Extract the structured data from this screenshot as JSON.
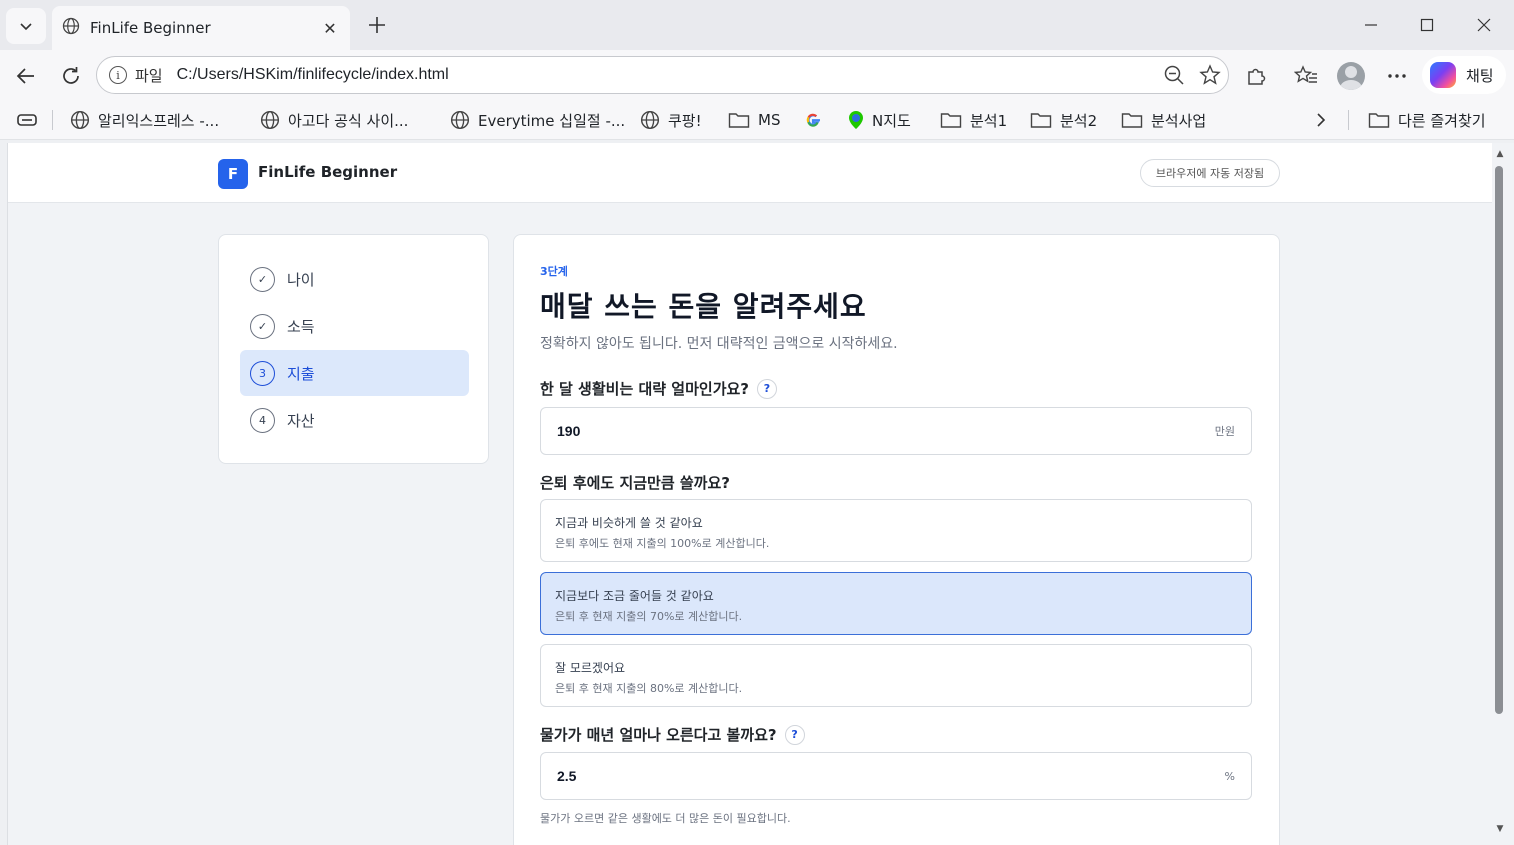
{
  "browser": {
    "tab_title": "FinLife Beginner",
    "address_label": "파일",
    "url": "C:/Users/HSKim/finlifecycle/index.html",
    "copilot_label": "채팅",
    "bookmarks": [
      "알리익스프레스 -...",
      "아고다 공식 사이...",
      "Everytime 십일절 -...",
      "쿠팡!",
      "MS",
      "N지도",
      "분석1",
      "분석2",
      "분석사업"
    ],
    "other_bookmarks": "다른 즐겨찾기"
  },
  "app": {
    "logo_letter": "F",
    "title": "FinLife Beginner",
    "autosave": "브라우저에 자동 저장됨"
  },
  "steps": [
    {
      "label": "나이",
      "marker": "✓",
      "state": "done"
    },
    {
      "label": "소득",
      "marker": "✓",
      "state": "done"
    },
    {
      "label": "지출",
      "marker": "3",
      "state": "active"
    },
    {
      "label": "자산",
      "marker": "4",
      "state": "pending"
    }
  ],
  "form": {
    "stage": "3단계",
    "title": "매달 쓰는 돈을 알려주세요",
    "subtitle": "정확하지 않아도 됩니다. 먼저 대략적인 금액으로 시작하세요.",
    "q1": {
      "label": "한 달 생활비는 대략 얼마인가요?",
      "help": "?",
      "value": "190",
      "unit": "만원"
    },
    "q2": {
      "label": "은퇴 후에도 지금만큼 쓸까요?",
      "options": [
        {
          "title": "지금과 비슷하게 쓸 것 같아요",
          "desc": "은퇴 후에도 현재 지출의 100%로 계산합니다."
        },
        {
          "title": "지금보다 조금 줄어들 것 같아요",
          "desc": "은퇴 후 현재 지출의 70%로 계산합니다."
        },
        {
          "title": "잘 모르겠어요",
          "desc": "은퇴 후 현재 지출의 80%로 계산합니다."
        }
      ],
      "selected_index": 1
    },
    "q3": {
      "label": "물가가 매년 얼마나 오른다고 볼까요?",
      "help": "?",
      "value": "2.5",
      "unit": "%",
      "hint": "물가가 오르면 같은 생활에도 더 많은 돈이 필요합니다."
    }
  }
}
